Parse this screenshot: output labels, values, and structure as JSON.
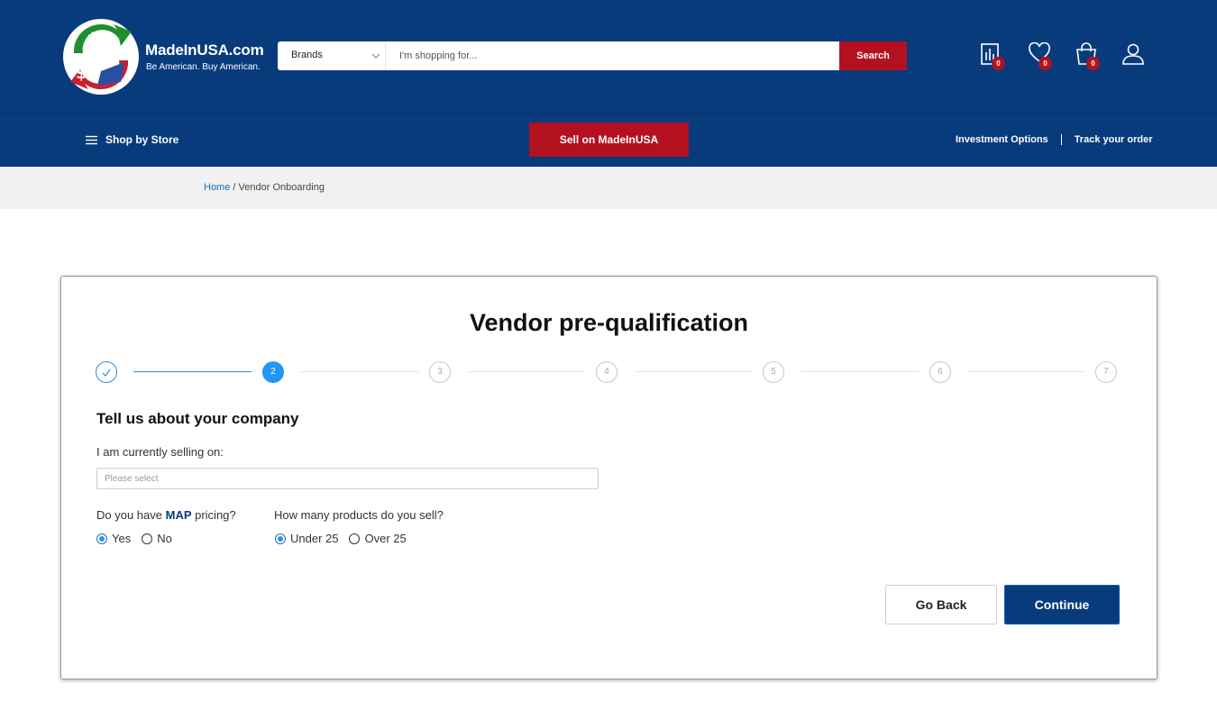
{
  "header": {
    "logo_title": "MadeInUSA.com",
    "logo_tagline": "Be American. Buy American.",
    "search": {
      "category": "Brands",
      "placeholder": "I'm shopping for...",
      "button_label": "Search"
    },
    "icons": [
      {
        "name": "compare-icon",
        "badge": "0"
      },
      {
        "name": "wishlist-heart-icon",
        "badge": "0"
      },
      {
        "name": "cart-bag-icon",
        "badge": "0"
      },
      {
        "name": "account-user-icon"
      }
    ]
  },
  "nav": {
    "shop_by_store": "Shop by Store",
    "sell_button": "Sell on MadeInUSA",
    "investment_options": "Investment Options",
    "track_order": "Track your order"
  },
  "breadcrumb": {
    "home": "Home",
    "separator": "/",
    "current": "Vendor Onboarding"
  },
  "form": {
    "title": "Vendor pre-qualification",
    "steps": [
      {
        "label": "",
        "state": "done"
      },
      {
        "label": "2",
        "state": "active"
      },
      {
        "label": "3",
        "state": "pending"
      },
      {
        "label": "4",
        "state": "pending"
      },
      {
        "label": "5",
        "state": "pending"
      },
      {
        "label": "6",
        "state": "pending"
      },
      {
        "label": "7",
        "state": "pending"
      }
    ],
    "section_title": "Tell us about your company",
    "selling_on_label": "I am currently selling on:",
    "selling_on_placeholder": "Please select",
    "map_question_prefix": "Do you have ",
    "map_question_bold": "MAP",
    "map_question_suffix": " pricing?",
    "map_options": {
      "yes": "Yes",
      "no": "No",
      "selected": "Yes"
    },
    "products_question": "How many products do you sell?",
    "products_options": {
      "under": "Under 25",
      "over": "Over 25",
      "selected": "Under 25"
    },
    "go_back": "Go Back",
    "continue": "Continue"
  },
  "colors": {
    "brand_blue": "#083b7c",
    "accent_red": "#b3111f",
    "step_blue": "#2196f3"
  }
}
